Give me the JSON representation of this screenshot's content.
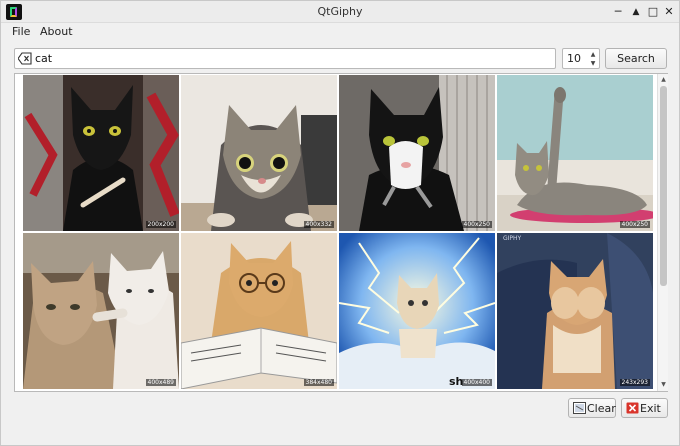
{
  "window": {
    "title": "QtGiphy"
  },
  "menu": {
    "file": "File",
    "about": "About"
  },
  "search": {
    "value": "cat",
    "placeholder": ""
  },
  "limit": {
    "value": "10"
  },
  "buttons": {
    "search": "Search",
    "clear": "Clear",
    "exit": "Exit"
  },
  "results": [
    {
      "size": "200x200",
      "bg": "#3a2e2a"
    },
    {
      "size": "400x332",
      "bg": "#e8e4de"
    },
    {
      "size": "400x250",
      "bg": "#6e6a66"
    },
    {
      "size": "400x250",
      "bg": "#a9cfd0"
    },
    {
      "size": "400x489",
      "bg": "#6b5a48"
    },
    {
      "size": "384x480",
      "bg": "#e9dccb"
    },
    {
      "size": "400x400",
      "bg": "#2f6fc0",
      "watermark": "sh"
    },
    {
      "size": "243x293",
      "bg": "#31415e",
      "watermark": "GIPHY"
    }
  ]
}
